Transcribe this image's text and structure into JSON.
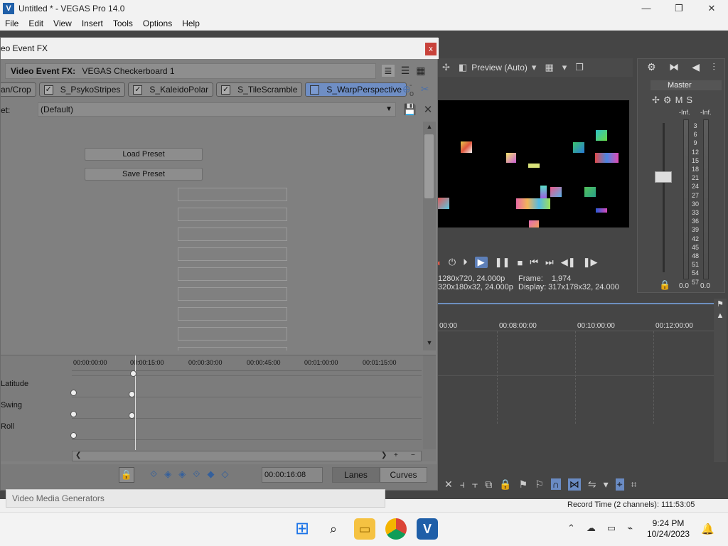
{
  "window": {
    "title": "Untitled * - VEGAS Pro 14.0",
    "minimize": "—",
    "maximize": "❐",
    "close": "✕"
  },
  "menu": [
    "File",
    "Edit",
    "View",
    "Insert",
    "Tools",
    "Options",
    "Help"
  ],
  "preview": {
    "mode": "Preview (Auto)",
    "project_info": "1280x720, 24.000p",
    "preview_info": "320x180x32, 24.000p",
    "frame_label": "Frame:",
    "frame_value": "1,974",
    "display_label": "Display:",
    "display_value": "317x178x32, 24.000"
  },
  "master_bus": {
    "label": "Master",
    "mute": "M",
    "solo": "S",
    "inf_left": "-Inf.",
    "inf_right": "-Inf.",
    "scale": [
      "3",
      "6",
      "9",
      "12",
      "15",
      "18",
      "21",
      "24",
      "27",
      "30",
      "33",
      "36",
      "39",
      "42",
      "45",
      "48",
      "51",
      "54",
      "57"
    ],
    "db_left": "0.0",
    "db_right": "0.0"
  },
  "timeline": {
    "ruler": [
      "00:00",
      "00:08:00:00",
      "00:10:00:00",
      "00:12:00:00"
    ]
  },
  "status": {
    "record_time": "Record Time (2 channels): 111:53:05"
  },
  "dialog": {
    "title": "eo Event FX",
    "close": "x",
    "header_label": "Video Event FX:",
    "header_value": "VEGAS Checkerboard 1",
    "chain": [
      {
        "label": "an/Crop",
        "checked": false
      },
      {
        "label": "S_PsykoStripes",
        "checked": true
      },
      {
        "label": "S_KaleidoPolar",
        "checked": true
      },
      {
        "label": "S_TileScramble",
        "checked": true
      },
      {
        "label": "S_WarpPerspective",
        "checked": false
      }
    ],
    "preset_label": "et:",
    "preset_value": "(Default)",
    "load_preset": "Load Preset",
    "save_preset": "Save Preset",
    "keyframes": {
      "ruler": [
        "00:00:00:00",
        "00:00:15:00",
        "00:00:30:00",
        "00:00:45:00",
        "00:01:00:00",
        "00:01:15:00"
      ],
      "rows": [
        "Latitude",
        "Swing",
        "Roll"
      ]
    },
    "time_value": "00:00:16:08",
    "lanes_label": "Lanes",
    "curves_label": "Curves"
  },
  "generators": {
    "label": "Video Media Generators"
  },
  "taskbar": {
    "time": "9:24 PM",
    "date": "10/24/2023"
  }
}
